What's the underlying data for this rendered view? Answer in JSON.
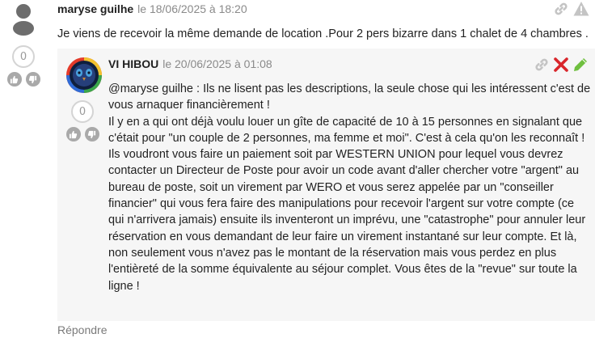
{
  "comment": {
    "author": "maryse guilhe",
    "date": "le 18/06/2025 à 18:20",
    "text": "Je viens de recevoir la même demande de location .Pour 2 pers bizarre dans 1 chalet de 4 chambres .",
    "score": "0"
  },
  "reply": {
    "author": "VI HIBOU",
    "date": "le 20/06/2025 à 01:08",
    "score": "0",
    "lines": [
      "@maryse guilhe : Ils ne lisent pas les descriptions, la seule chose qui les intéressent c'est de",
      "vous arnaquer financièrement !",
      "Il y en a qui ont déjà voulu louer un gîte de capacité de 10 à 15 personnes en signalant que",
      "c'était pour \"un couple de 2 personnes, ma femme et moi\". C'est à cela qu'on les reconnaît !",
      "Ils voudront vous faire un paiement soit par WESTERN UNION pour lequel vous devrez",
      "contacter un Directeur de Poste pour avoir un code avant d'aller chercher votre \"argent\" au",
      "bureau de poste, soit un virement par WERO et vous serez appelée par un \"conseiller",
      "financier\" qui vous fera faire des manipulations pour recevoir l'argent sur votre compte (ce",
      "qui n'arrivera jamais) ensuite ils inventeront un imprévu, une \"catastrophe\" pour annuler leur",
      "réservation en vous demandant de leur faire un virement instantané sur leur compte. Et là,",
      "non seulement vous n'avez pas le montant de la réservation mais vous perdez en plus",
      "l'entièreté de la somme équivalente au séjour complet. Vous êtes de la \"revue\" sur toute la",
      "ligne !"
    ]
  },
  "reply_link": "Répondre",
  "colors": {
    "icon_gray": "#c4c4c4",
    "delete_red": "#d9262b",
    "edit_green": "#6fbf3f",
    "reply_bg": "#f6f6f6"
  }
}
